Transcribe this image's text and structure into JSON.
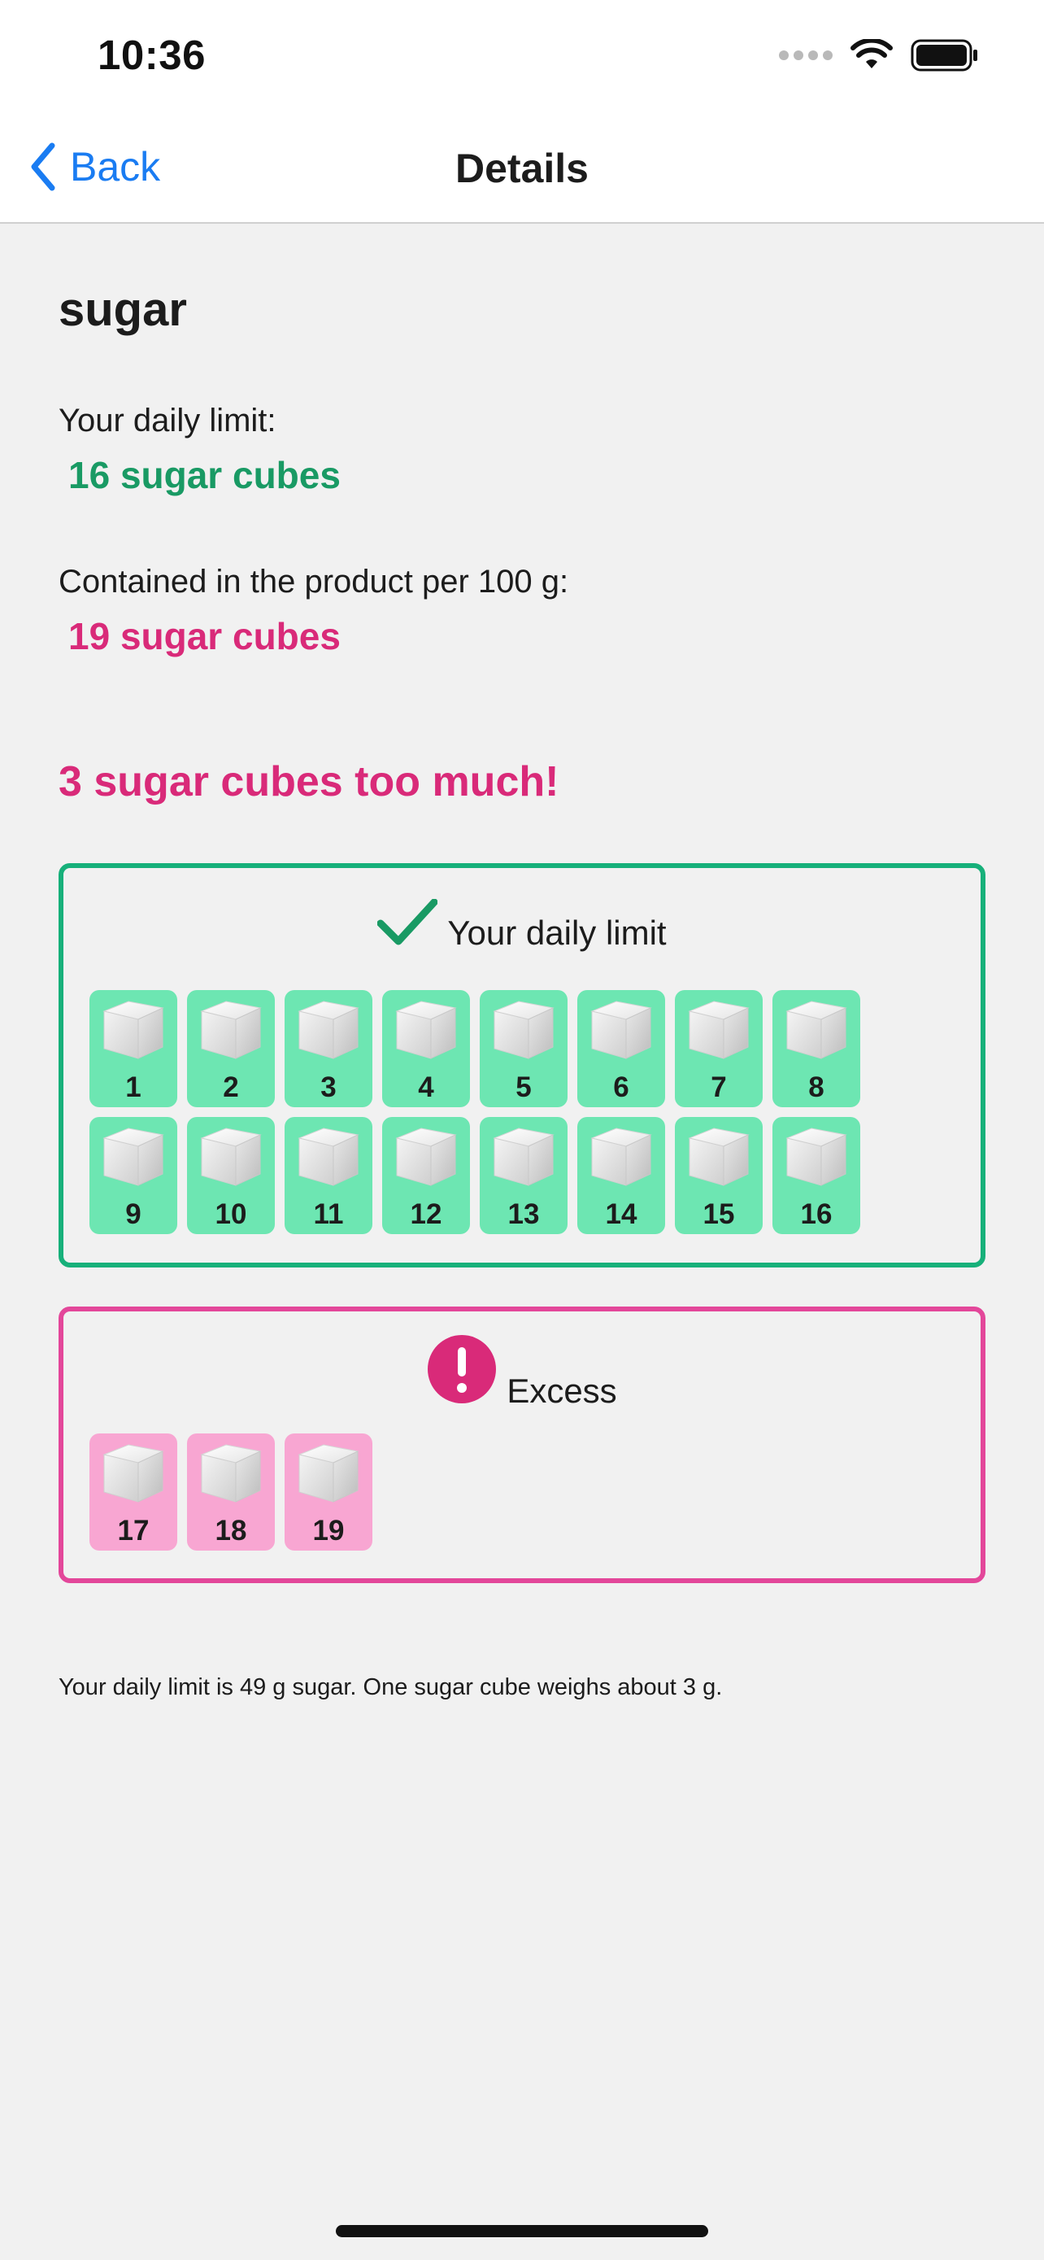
{
  "status_bar": {
    "time": "10:36",
    "icons": [
      "signal-icon",
      "wifi-icon",
      "battery-icon"
    ]
  },
  "nav": {
    "back_label": "Back",
    "title": "Details"
  },
  "product": {
    "name": "sugar",
    "daily_limit_label": "Your daily limit:",
    "daily_limit_value": "16 sugar cubes",
    "contained_label": "Contained in the product per 100 g:",
    "contained_value": "19 sugar cubes",
    "excess_message": "3 sugar cubes too much!"
  },
  "limit_panel": {
    "icon": "checkmark-icon",
    "label": "Your daily limit",
    "cubes": [
      "1",
      "2",
      "3",
      "4",
      "5",
      "6",
      "7",
      "8",
      "9",
      "10",
      "11",
      "12",
      "13",
      "14",
      "15",
      "16"
    ]
  },
  "excess_panel": {
    "icon": "exclamation-icon",
    "label": "Excess",
    "cubes": [
      "17",
      "18",
      "19"
    ]
  },
  "footnote": "Your daily limit is 49 g sugar. One sugar cube weighs about 3 g.",
  "colors": {
    "accent_blue": "#1a7cf2",
    "limit_green": "#199a64",
    "limit_border": "#17b07a",
    "limit_tile": "#6de6b2",
    "excess_pink": "#d92a79",
    "excess_border": "#e3479a",
    "excess_tile": "#f8a6d2"
  }
}
